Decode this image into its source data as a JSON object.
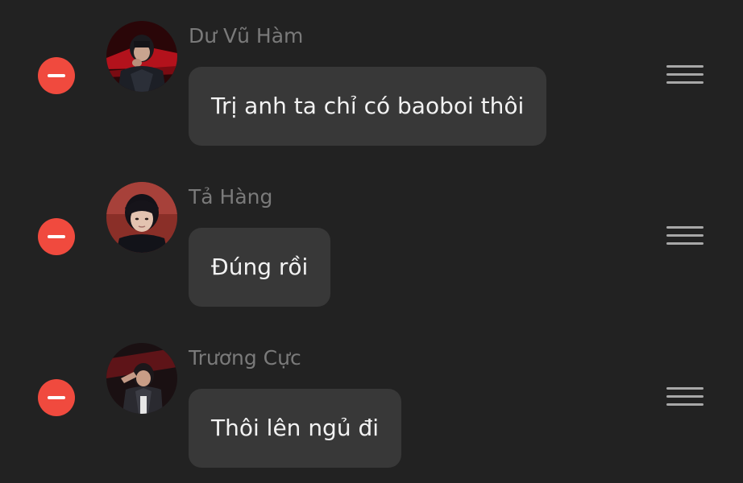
{
  "messages": [
    {
      "sender": "Dư Vũ Hàm",
      "text": "Trị anh ta chỉ có baoboi thôi",
      "avatar_icon": "avatar-photo"
    },
    {
      "sender": "Tả Hàng",
      "text": "Đúng rồi",
      "avatar_icon": "avatar-photo"
    },
    {
      "sender": "Trương Cực",
      "text": "Thôi lên ngủ đi",
      "avatar_icon": "avatar-photo"
    }
  ],
  "controls": {
    "delete_icon": "remove-circle-icon",
    "reorder_icon": "drag-handle-icon"
  },
  "colors": {
    "background": "#222222",
    "bubble": "#383838",
    "delete": "#f04a3e",
    "sender_name": "#7a7a7a",
    "message_text": "#f2f2f2",
    "handle": "#a8a8a8"
  }
}
